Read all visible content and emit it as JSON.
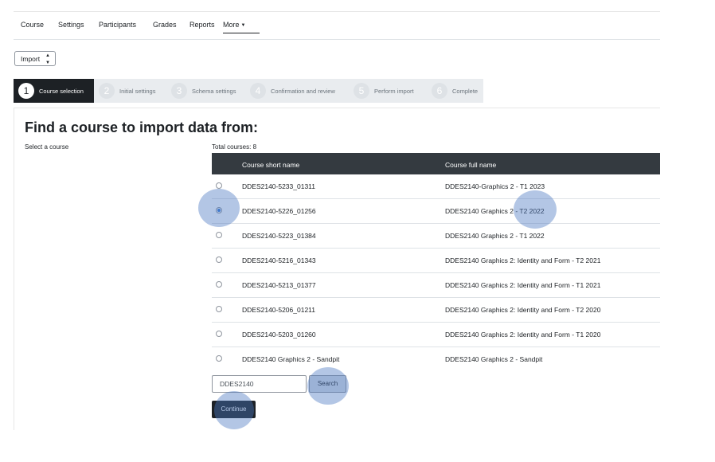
{
  "nav": {
    "items": [
      "Course",
      "Settings",
      "Participants",
      "Grades",
      "Reports",
      "More"
    ]
  },
  "action_select": {
    "value": "Import"
  },
  "steps": [
    {
      "num": "1",
      "label": "Course selection"
    },
    {
      "num": "2",
      "label": "Initial settings"
    },
    {
      "num": "3",
      "label": "Schema settings"
    },
    {
      "num": "4",
      "label": "Confirmation and review"
    },
    {
      "num": "5",
      "label": "Perform import"
    },
    {
      "num": "6",
      "label": "Complete"
    }
  ],
  "main": {
    "title": "Find a course to import data from:",
    "select_label": "Select a course",
    "total_courses": "Total courses: 8"
  },
  "table": {
    "headers": [
      "Course short name",
      "Course full name"
    ],
    "rows": [
      {
        "short": "DDES2140-5233_01311",
        "full": "DDES2140-Graphics 2 - T1 2023"
      },
      {
        "short": "DDES2140-5226_01256",
        "full": "DDES2140 Graphics 2 - T2 2022"
      },
      {
        "short": "DDES2140-5223_01384",
        "full": "DDES2140 Graphics 2 - T1 2022"
      },
      {
        "short": "DDES2140-5216_01343",
        "full": "DDES2140 Graphics 2: Identity and Form - T2 2021"
      },
      {
        "short": "DDES2140-5213_01377",
        "full": "DDES2140 Graphics 2: Identity and Form - T1 2021"
      },
      {
        "short": "DDES2140-5206_01211",
        "full": "DDES2140 Graphics 2: Identity and Form - T2 2020"
      },
      {
        "short": "DDES2140-5203_01260",
        "full": "DDES2140 Graphics 2: Identity and Form - T1 2020"
      },
      {
        "short": "DDES2140 Graphics 2 - Sandpit",
        "full": "DDES2140 Graphics 2 - Sandpit"
      }
    ]
  },
  "search": {
    "value": "DDES2140",
    "button": "Search"
  },
  "continue_label": "Continue",
  "colors": {
    "dark": "#1d2125",
    "accent": "#3a7bd5",
    "click_marker": "#4a78c2"
  }
}
